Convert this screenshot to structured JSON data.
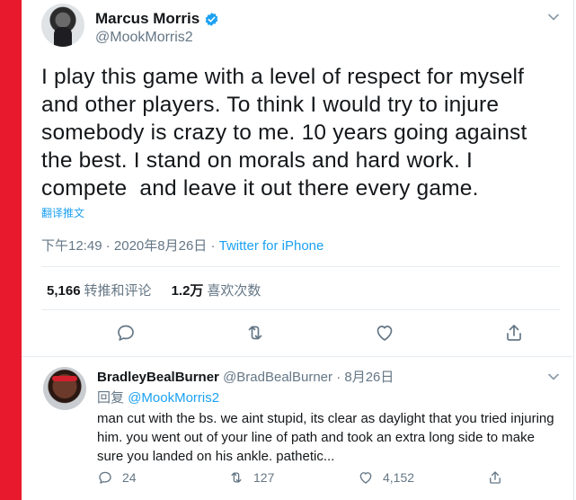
{
  "tweet": {
    "display_name": "Marcus Morris",
    "handle": "@MookMorris2",
    "text": "I play this game with a level of respect for myself\nand other players. To think I would try to injure\nsomebody is crazy to me. 10 years going against\nthe best. I stand on morals and hard work. I\ncompete  and leave it out there every game.",
    "translate_label": "翻译推文",
    "time": "下午12:49",
    "date": "2020年8月26日",
    "separator": "·",
    "source": "Twitter for iPhone",
    "retweets_count": "5,166",
    "retweets_label": "转推和评论",
    "likes_count": "1.2万",
    "likes_label": "喜欢次数"
  },
  "reply": {
    "display_name": "BradleyBealBurner",
    "handle": "@BradBealBurner",
    "separator": "·",
    "date": "8月26日",
    "reply_prefix": "回复",
    "reply_to": "@MookMorris2",
    "text": "man cut with the bs. we aint stupid, its clear as daylight that you tried injuring him. you went out of your line of path and took an extra long side to make sure you landed on his ankle. pathetic...",
    "reply_count": "24",
    "retweet_count": "127",
    "like_count": "4,152"
  },
  "colors": {
    "accent": "#1da1f2",
    "side_bar": "#e8192c",
    "secondary_text": "#657786"
  },
  "icons": [
    "verified-badge-icon",
    "chevron-down-icon",
    "reply-icon",
    "retweet-icon",
    "like-icon",
    "share-icon"
  ]
}
